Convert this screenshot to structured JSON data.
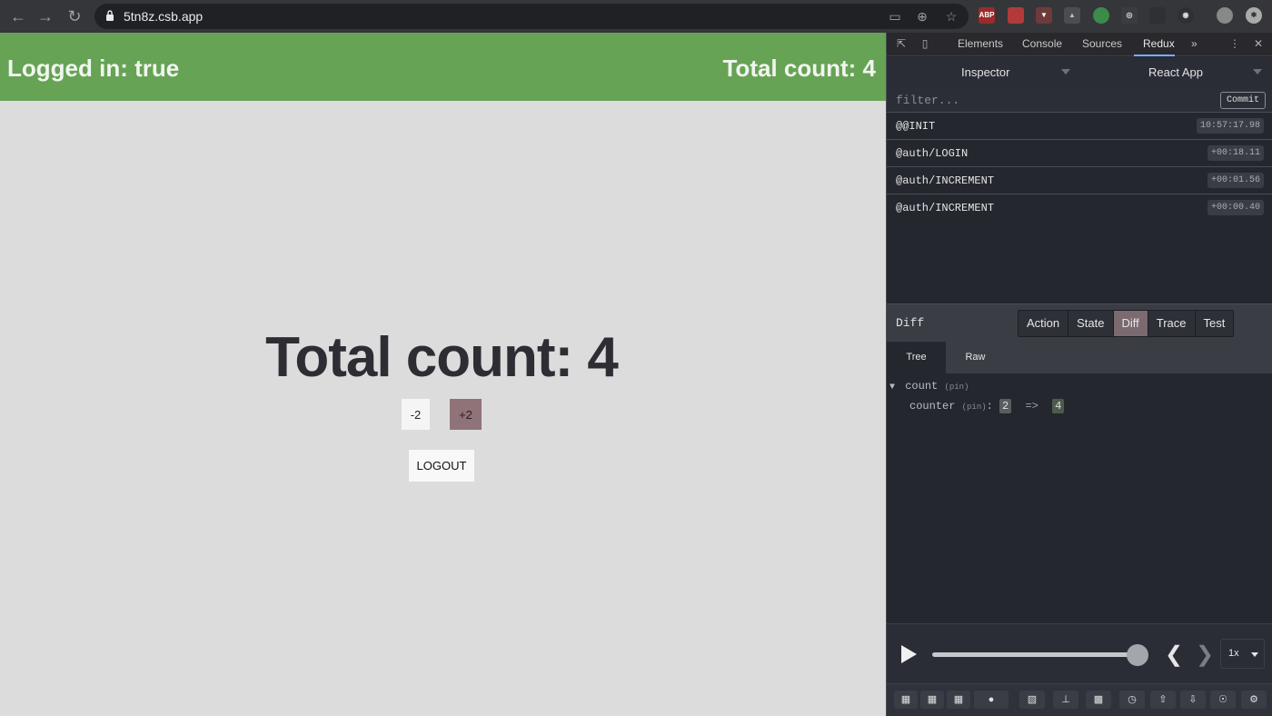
{
  "browser": {
    "url": "5tn8z.csb.app",
    "ext_abp": "ABP"
  },
  "app": {
    "logged_in": "Logged in: true",
    "header_count": "Total count: 4",
    "main_count": "Total count: 4",
    "dec_label": "-2",
    "inc_label": "+2",
    "logout_label": "LOGOUT",
    "colors": {
      "header_bg": "#66a355",
      "page_bg": "#dcdcdc",
      "inc_bg": "#8f7378"
    }
  },
  "devtools": {
    "tabs": [
      "Elements",
      "Console",
      "Sources",
      "Redux"
    ],
    "active_tab": "Redux",
    "more": "»"
  },
  "redux": {
    "inspector_label": "Inspector",
    "instance_label": "React App",
    "filter_placeholder": "filter...",
    "commit_label": "Commit",
    "actions": [
      {
        "name": "@@INIT",
        "time": "10:57:17.98"
      },
      {
        "name": "@auth/LOGIN",
        "time": "+00:18.11"
      },
      {
        "name": "@auth/INCREMENT",
        "time": "+00:01.56"
      },
      {
        "name": "@auth/INCREMENT",
        "time": "+00:00.40"
      }
    ],
    "monitor_title": "Diff",
    "monitor_tabs": [
      "Action",
      "State",
      "Diff",
      "Trace",
      "Test"
    ],
    "active_monitor_tab": "Diff",
    "sub_tabs": [
      "Tree",
      "Raw"
    ],
    "active_sub_tab": "Tree",
    "tree": {
      "root_key": "count",
      "root_pin": "(pin)",
      "child_key": "counter",
      "child_pin": "(pin)",
      "old_value": "2",
      "arrow": "=>",
      "new_value": "4"
    },
    "speed": "1x",
    "slider_position": 1.0
  }
}
